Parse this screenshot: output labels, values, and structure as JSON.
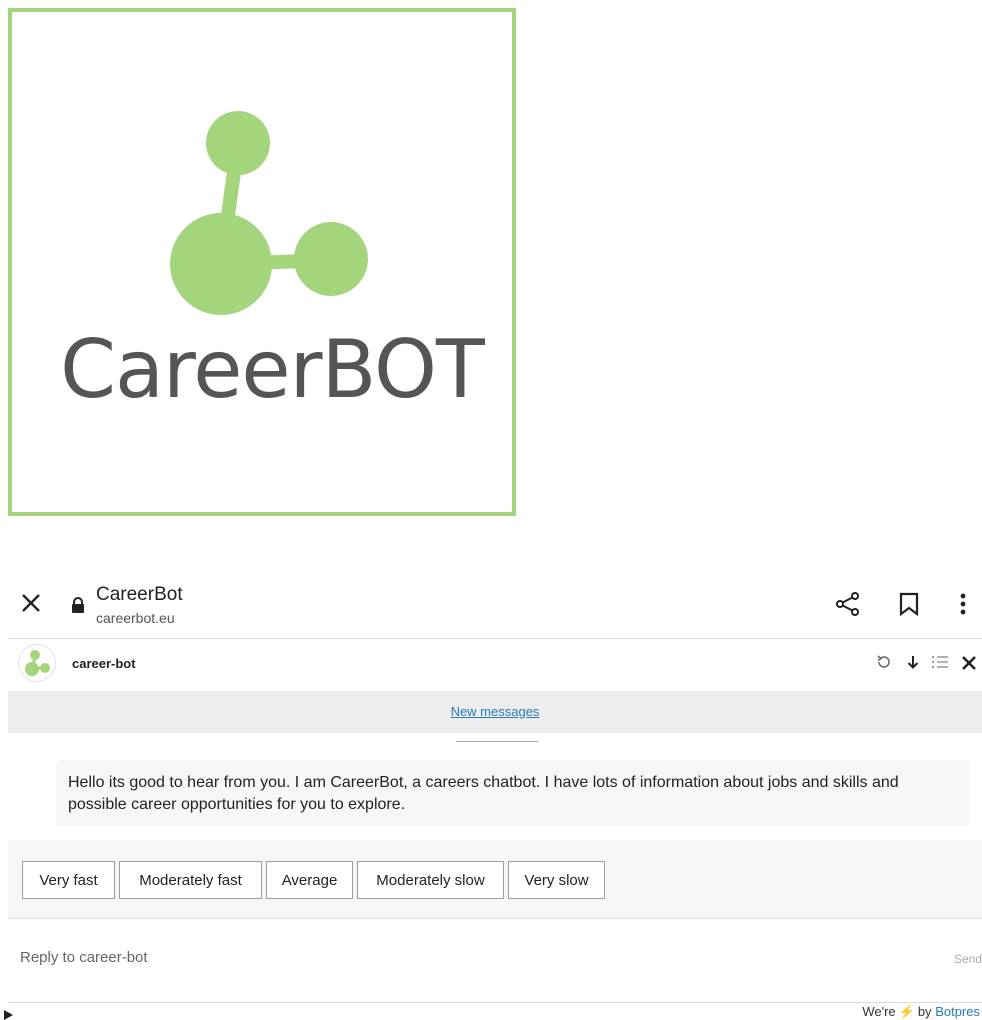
{
  "logo": {
    "wordmark": "CareerBOT",
    "colors": {
      "border": "#a4d47c",
      "circles": "#a4d47c",
      "text": "#555555"
    }
  },
  "browser": {
    "title": "CareerBot",
    "url": "careerbot.eu",
    "icons": [
      "close-icon",
      "lock-icon",
      "share-icon",
      "bookmark-icon",
      "more-vert-icon"
    ]
  },
  "chat": {
    "bot_name": "career-bot",
    "header_icons": [
      "refresh-icon",
      "download-icon",
      "list-icon",
      "close-icon"
    ],
    "new_messages_label": "New messages",
    "message": "Hello its good to hear from you. I am CareerBot, a careers chatbot. I have lots of information about jobs and skills and possible career opportunities for you to explore.",
    "quick_replies": [
      "Very fast",
      "Moderately fast",
      "Average",
      "Moderately slow",
      "Very slow"
    ],
    "composer": {
      "placeholder": "Reply to career-bot",
      "send_label": "Send"
    }
  },
  "footer": {
    "prefix": "We're",
    "suffix": "by",
    "brand": "Botpres"
  },
  "colors": {
    "accent_link": "#2a7ab3",
    "banner_bg": "#ecedef",
    "bolt": "#f3b21b"
  }
}
